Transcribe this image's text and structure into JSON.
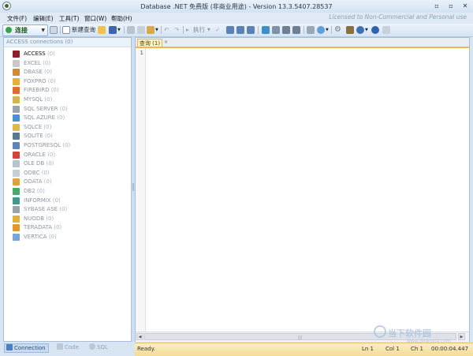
{
  "window": {
    "title": "Database .NET 免费版 (非商业用途) - Version 13.3.5407.28537",
    "controls": [
      "▫",
      "▫",
      "✕"
    ]
  },
  "menu": {
    "items": [
      "文件(F)",
      "编辑(E)",
      "工具(T)",
      "窗口(W)",
      "帮助(H)"
    ],
    "watermark": "Licensed to Non-Commercial and Personal use"
  },
  "toolbar": {
    "connect_label": "连接",
    "new_query_label": "新建查询",
    "execute_label": "执行"
  },
  "left_panel": {
    "header": "ACCESS connections (0)",
    "items": [
      {
        "name": "ACCESS",
        "count": "(0)",
        "icon": "access-db-icon",
        "color": "#8d1f2b"
      },
      {
        "name": "EXCEL",
        "count": "(0)",
        "icon": "excel-icon",
        "color": "#c9c9c9"
      },
      {
        "name": "DBASE",
        "count": "(0)",
        "icon": "dbase-icon",
        "color": "#d08a3a"
      },
      {
        "name": "FOXPRO",
        "count": "(0)",
        "icon": "foxpro-icon",
        "color": "#e7b032"
      },
      {
        "name": "FIREBIRD",
        "count": "(0)",
        "icon": "firebird-icon",
        "color": "#e46b2a"
      },
      {
        "name": "MYSQL",
        "count": "(0)",
        "icon": "mysql-icon",
        "color": "#d6b64a"
      },
      {
        "name": "SQL SERVER",
        "count": "(0)",
        "icon": "sqlserver-icon",
        "color": "#9aa3ad"
      },
      {
        "name": "SQL AZURE",
        "count": "(0)",
        "icon": "sqlazure-icon",
        "color": "#4a8fd6"
      },
      {
        "name": "SQLCE",
        "count": "(0)",
        "icon": "sqlce-icon",
        "color": "#e0b84a"
      },
      {
        "name": "SQLITE",
        "count": "(0)",
        "icon": "sqlite-icon",
        "color": "#5b7891"
      },
      {
        "name": "POSTGRESQL",
        "count": "(0)",
        "icon": "postgresql-icon",
        "color": "#5c86b8"
      },
      {
        "name": "ORACLE",
        "count": "(0)",
        "icon": "oracle-icon",
        "color": "#d2463a"
      },
      {
        "name": "OLE DB",
        "count": "(0)",
        "icon": "oledb-icon",
        "color": "#b8c3cf"
      },
      {
        "name": "ODBC",
        "count": "(0)",
        "icon": "odbc-icon",
        "color": "#c8ced6"
      },
      {
        "name": "ODATA",
        "count": "(0)",
        "icon": "odata-icon",
        "color": "#e2a23a"
      },
      {
        "name": "DB2",
        "count": "(0)",
        "icon": "db2-icon",
        "color": "#4aa86a"
      },
      {
        "name": "INFORMIX",
        "count": "(0)",
        "icon": "informix-icon",
        "color": "#3e9a8a"
      },
      {
        "name": "SYBASE ASE",
        "count": "(0)",
        "icon": "sybase-icon",
        "color": "#9aa3ad"
      },
      {
        "name": "NUODB",
        "count": "(0)",
        "icon": "nuodb-icon",
        "color": "#e1b23a"
      },
      {
        "name": "TERADATA",
        "count": "(0)",
        "icon": "teradata-icon",
        "color": "#e4972f"
      },
      {
        "name": "VERTICA",
        "count": "(0)",
        "icon": "vertica-icon",
        "color": "#7aa6d6"
      }
    ]
  },
  "editor": {
    "tab_label": "查询 (1)",
    "tab_close": "×",
    "line_number": "1"
  },
  "bottom_tabs": {
    "connection": "Connection",
    "code": "Code",
    "sql": "SQL"
  },
  "status": {
    "ready": "Ready.",
    "ln": "Ln 1",
    "col": "Col 1",
    "ch": "Ch 1",
    "time": "00:00:04.447"
  },
  "brand": {
    "name": "当下软件园",
    "sub": "www.downxia.com"
  }
}
